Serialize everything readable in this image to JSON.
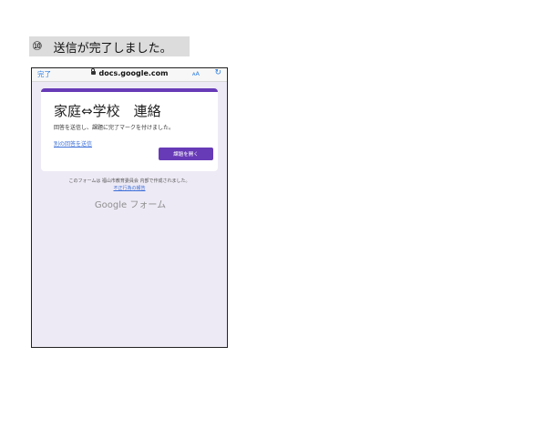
{
  "step": {
    "number": "⑩",
    "text": "送信が完了しました。"
  },
  "browser": {
    "done_label": "完了",
    "url": "docs.google.com",
    "text_size_label": "ᴀA",
    "reload_symbol": "↻"
  },
  "form": {
    "title": "家庭⇔学校　連絡",
    "confirmation": "回答を送信し、課題に完了マークを付けました。",
    "another_response_link": "別の回答を送信",
    "open_assignment_button": "課題を開く",
    "creator_note": "このフォームは 福山市教育委員会 内部で作成されました。",
    "report_abuse_link": "不正行為の報告",
    "brand": "Google フォーム"
  },
  "colors": {
    "accent": "#673ab7",
    "page_background": "#eeeaf5",
    "link": "#3c6fd8"
  }
}
